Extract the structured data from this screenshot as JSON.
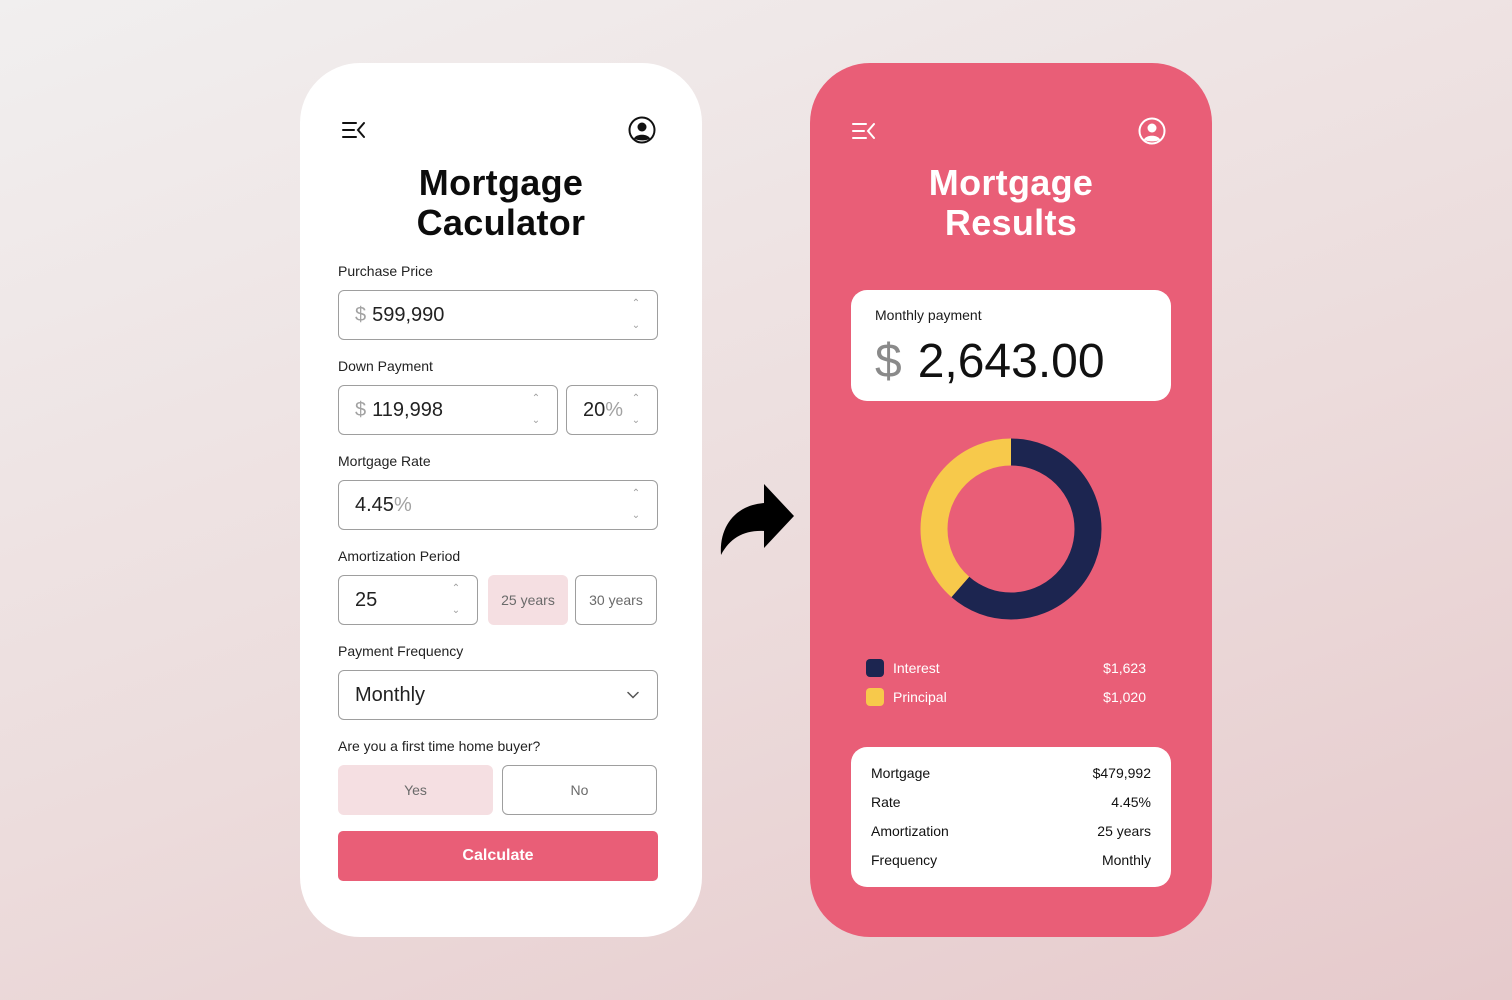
{
  "calculator": {
    "title_line1": "Mortgage",
    "title_line2": "Caculator",
    "purchase_price": {
      "label": "Purchase Price",
      "currency": "$",
      "value": "599,990"
    },
    "down_payment": {
      "label": "Down Payment",
      "currency": "$",
      "value": "119,998",
      "percent_value": "20",
      "percent_sign": "%"
    },
    "mortgage_rate": {
      "label": "Mortgage Rate",
      "value": "4.45",
      "percent_sign": "%"
    },
    "amortization": {
      "label": "Amortization Period",
      "value": "25",
      "options": [
        "25 years",
        "30 years"
      ],
      "selected": "25 years"
    },
    "payment_frequency": {
      "label": "Payment Frequency",
      "value": "Monthly"
    },
    "first_time_buyer": {
      "label": "Are you a first time home buyer?",
      "options": [
        "Yes",
        "No"
      ],
      "selected": "Yes"
    },
    "calculate_label": "Calculate"
  },
  "results": {
    "title_line1": "Mortgage",
    "title_line2": "Results",
    "monthly_payment": {
      "label": "Monthly payment",
      "currency": "$",
      "value": "2,643.00"
    },
    "breakdown": [
      {
        "name": "Interest",
        "value": "$1,623",
        "amount": 1623,
        "color": "#1c2550"
      },
      {
        "name": "Principal",
        "value": "$1,020",
        "amount": 1020,
        "color": "#f7c94b"
      }
    ],
    "summary": [
      {
        "label": "Mortgage",
        "value": "$479,992"
      },
      {
        "label": "Rate",
        "value": "4.45%"
      },
      {
        "label": "Amortization",
        "value": "25 years"
      },
      {
        "label": "Frequency",
        "value": "Monthly"
      }
    ]
  },
  "colors": {
    "accent": "#e95e77",
    "selected_bg": "#f5dfe2",
    "interest": "#1c2550",
    "principal": "#f7c94b"
  },
  "icons": [
    "menu-collapse-icon",
    "user-avatar-icon",
    "spinner-up-icon",
    "spinner-down-icon",
    "chevron-down-icon",
    "share-arrow-icon"
  ]
}
